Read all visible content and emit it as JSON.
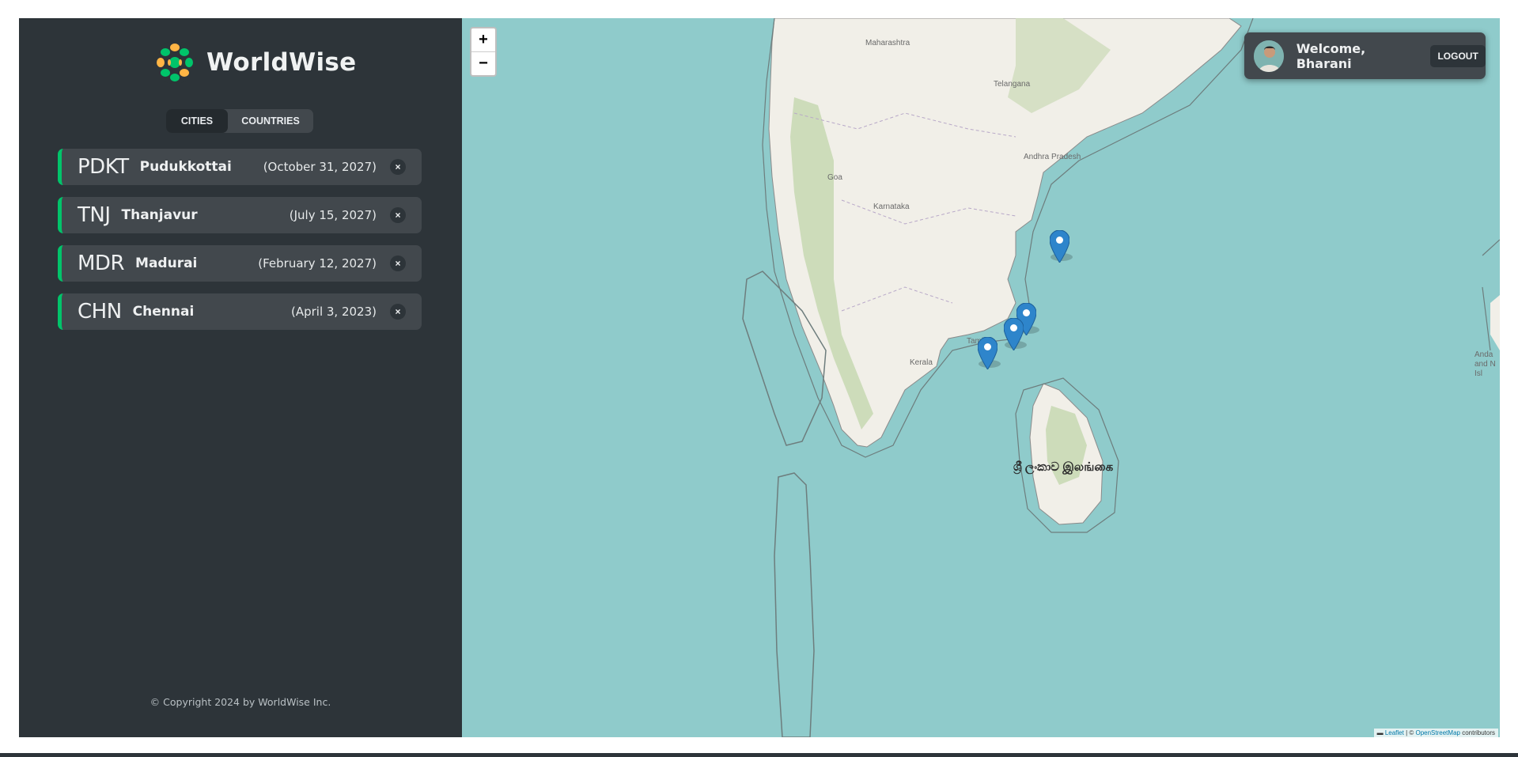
{
  "app": {
    "name": "WorldWise"
  },
  "tabs": {
    "cities": "Cities",
    "countries": "Countries"
  },
  "cities": [
    {
      "code": "PDKT",
      "name": "Pudukkottai",
      "date": "(October 31, 2027)",
      "delete": "×"
    },
    {
      "code": "TNJ",
      "name": "Thanjavur",
      "date": "(July 15, 2027)",
      "delete": "×"
    },
    {
      "code": "MDR",
      "name": "Madurai",
      "date": "(February 12, 2027)",
      "delete": "×"
    },
    {
      "code": "CHN",
      "name": "Chennai",
      "date": "(April 3, 2023)",
      "delete": "×"
    }
  ],
  "footer": {
    "copyright": "© Copyright 2024 by WorldWise Inc."
  },
  "map": {
    "zoom_in": "+",
    "zoom_out": "−",
    "labels": {
      "maharashtra": "Maharashtra",
      "telangana": "Telangana",
      "andhra": "Andhra Pradesh",
      "karnataka": "Karnataka",
      "goa": "Goa",
      "tamil": "Tamil N",
      "kerala": "Kerala",
      "srilanka": "ශ්‍රී ලංකාව  இலங்கை",
      "andaman": "Anda and N Isl"
    },
    "attribution": {
      "leaflet": "Leaflet",
      "sep": " | © ",
      "osm": "OpenStreetMap",
      "contrib": " contributors"
    }
  },
  "user": {
    "welcome": "Welcome, Bharani",
    "logout": "Logout"
  },
  "colors": {
    "accent": "#00c46a",
    "sidebar": "#2d3439",
    "panel": "#42484d",
    "sea": "#8fcbcb",
    "land": "#f1efe8"
  }
}
